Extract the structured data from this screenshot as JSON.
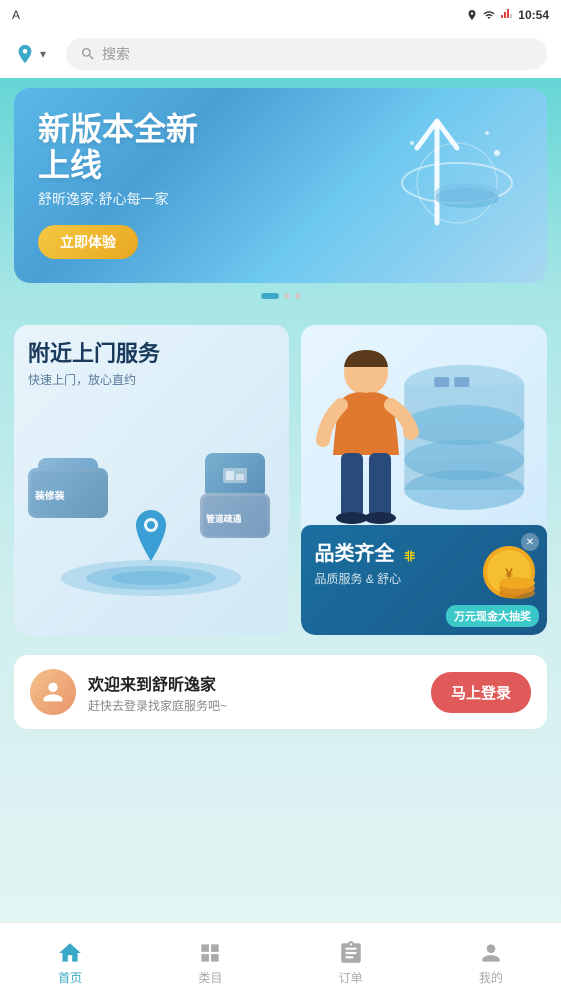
{
  "status_bar": {
    "left": "A",
    "time": "10:54",
    "icons": [
      "location",
      "wifi",
      "signal",
      "battery"
    ]
  },
  "top_nav": {
    "location_label": "",
    "search_placeholder": "搜索"
  },
  "banner": {
    "title_line1": "新版本全新",
    "title_line2": "上线",
    "subtitle": "舒昕逸家·舒心每一家",
    "cta_button": "立即体验"
  },
  "cards": {
    "left": {
      "title": "附近上门服务",
      "subtitle": "快速上门，放心直约"
    },
    "right": {
      "promo_title": "品类齐全",
      "promo_badge": "非",
      "promo_sub": "品质服务 & 舒心",
      "promo_lucky": "万元现金大抽奖"
    }
  },
  "welcome": {
    "title": "欢迎来到舒昕逸家",
    "subtitle": "赶快去登录找家庭服务吧~",
    "login_button": "马上登录"
  },
  "bottom_nav": {
    "items": [
      {
        "label": "首页",
        "icon": "🏠",
        "active": true
      },
      {
        "label": "类目",
        "icon": "⊞",
        "active": false
      },
      {
        "label": "订单",
        "icon": "📋",
        "active": false
      },
      {
        "label": "我的",
        "icon": "👤",
        "active": false
      }
    ]
  }
}
